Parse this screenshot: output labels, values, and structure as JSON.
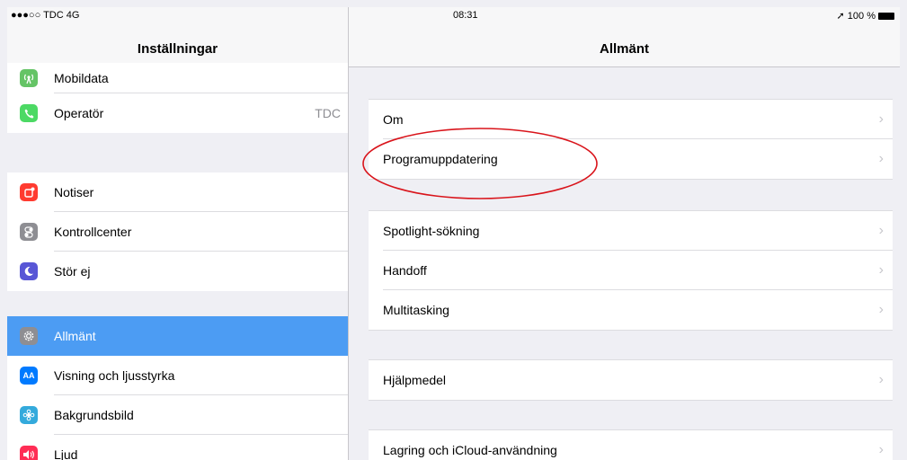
{
  "statusbar": {
    "carrier": "●●●○○ TDC  4G",
    "time": "08:31",
    "battery_text": "➚ 100 %"
  },
  "left": {
    "title": "Inställningar",
    "group1": [
      {
        "label": "Mobildata",
        "icon": "antenna-icon",
        "color": "#65c466"
      },
      {
        "label": "Operatör",
        "value": "TDC",
        "icon": "phone-icon",
        "color": "#4cd964"
      }
    ],
    "group2": [
      {
        "label": "Notiser",
        "icon": "notifications-icon",
        "color": "#ff3b30"
      },
      {
        "label": "Kontrollcenter",
        "icon": "toggles-icon",
        "color": "#8e8e93"
      },
      {
        "label": "Stör ej",
        "icon": "moon-icon",
        "color": "#5856d6"
      }
    ],
    "group3": [
      {
        "label": "Allmänt",
        "icon": "gear-icon",
        "color": "#8e8e93",
        "selected": true
      },
      {
        "label": "Visning och ljusstyrka",
        "icon": "text-size-icon",
        "color": "#007aff"
      },
      {
        "label": "Bakgrundsbild",
        "icon": "flower-icon",
        "color": "#34aadc"
      },
      {
        "label": "Ljud",
        "icon": "speaker-icon",
        "color": "#ff2d55"
      }
    ]
  },
  "right": {
    "title": "Allmänt",
    "group1": [
      "Om",
      "Programuppdatering"
    ],
    "group2": [
      "Spotlight-sökning",
      "Handoff",
      "Multitasking"
    ],
    "group3": [
      "Hjälpmedel"
    ],
    "group4": [
      "Lagring och iCloud-användning"
    ],
    "chevron": "›"
  },
  "colors": {
    "selected": "#4c9cf3",
    "annotation": "#d9141b"
  }
}
